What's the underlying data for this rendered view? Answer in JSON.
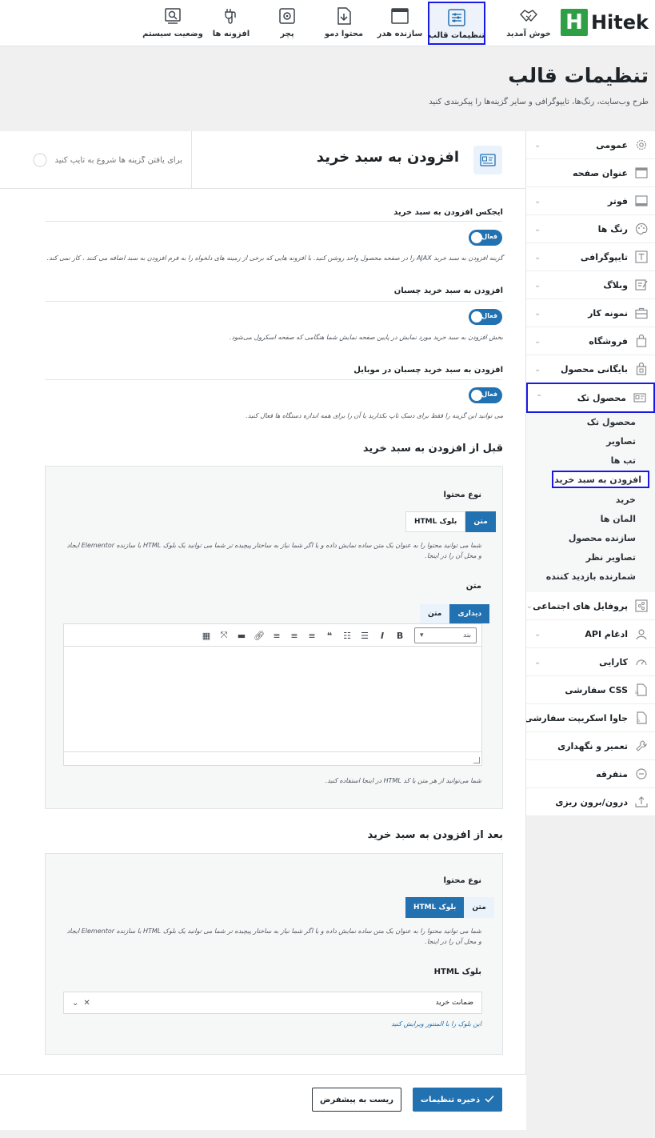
{
  "brand": {
    "logo_letter": "H",
    "logo_text": "Hitek",
    "logo_color": "#2f9f46"
  },
  "top_nav": {
    "items": [
      {
        "label": "خوش آمدید",
        "icon": "handshake-icon"
      },
      {
        "label": "تنظیمات قالب",
        "icon": "settings-panel-icon",
        "active": true
      },
      {
        "label": "سازنده هدر",
        "icon": "window-icon"
      },
      {
        "label": "محتوا دمو",
        "icon": "import-file-icon"
      },
      {
        "label": "پچر",
        "icon": "patch-gear-icon"
      },
      {
        "label": "افزونه ها",
        "icon": "plug-icon"
      },
      {
        "label": "وضعیت سیستم",
        "icon": "system-status-icon"
      }
    ]
  },
  "page": {
    "title": "تنظیمات قالب",
    "subtitle": "طرح وب‌سایت، رنگ‌ها، تایپوگرافی و سایر گزینه‌ها را پیکربندی کنید"
  },
  "sidebar": {
    "items": [
      {
        "label": "عمومی",
        "icon": "gear-icon",
        "chevron": true
      },
      {
        "label": "عنوان صفحه",
        "icon": "title-bar-icon",
        "chevron": false
      },
      {
        "label": "فوتر",
        "icon": "footer-icon",
        "chevron": true
      },
      {
        "label": "رنگ ها",
        "icon": "palette-icon",
        "chevron": true
      },
      {
        "label": "تایپوگرافی",
        "icon": "typography-icon",
        "chevron": true
      },
      {
        "label": "وبلاگ",
        "icon": "blog-icon",
        "chevron": true
      },
      {
        "label": "نمونه کار",
        "icon": "briefcase-icon",
        "chevron": true
      },
      {
        "label": "فروشگاه",
        "icon": "shopping-bag-icon",
        "chevron": true
      },
      {
        "label": "بایگانی محصول",
        "icon": "archive-bag-icon",
        "chevron": true
      },
      {
        "label": "محصول تک",
        "icon": "single-product-icon",
        "chevron": true,
        "active": true,
        "expanded": true
      }
    ],
    "sub_items": [
      {
        "label": "محصول تک"
      },
      {
        "label": "تصاویر"
      },
      {
        "label": "تب ها"
      },
      {
        "label": "افزودن به سبد خرید",
        "active": true
      },
      {
        "label": "خرید"
      },
      {
        "label": "المان ها"
      },
      {
        "label": "سازنده محصول"
      },
      {
        "label": "تصاویر نظر"
      },
      {
        "label": "شمارنده بازدید کننده"
      }
    ],
    "items_after": [
      {
        "label": "پروفایل های اجتماعی",
        "icon": "social-icon",
        "chevron": true
      },
      {
        "label": "ادغام API",
        "icon": "api-icon",
        "chevron": true
      },
      {
        "label": "کارایی",
        "icon": "speedometer-icon",
        "chevron": true
      },
      {
        "label": "CSS سفارشی",
        "icon": "css-file-icon",
        "chevron": false
      },
      {
        "label": "جاوا اسکریپت سفارشی",
        "icon": "js-file-icon",
        "chevron": false
      },
      {
        "label": "تعمیر و نگهداری",
        "icon": "wrench-icon",
        "chevron": false
      },
      {
        "label": "متفرقه",
        "icon": "more-circle-icon",
        "chevron": false
      },
      {
        "label": "درون/برون ریزی",
        "icon": "import-export-icon",
        "chevron": false
      }
    ]
  },
  "panel": {
    "title": "افزودن به سبد خرید",
    "search_placeholder": "برای یافتن گزینه ها شروع به تایپ کنید",
    "options": [
      {
        "label": "ایجکس افزودن به سبد خرید",
        "toggle": "فعال",
        "description": "گزینه افزودن به سبد خرید AJAX را در صفحه محصول واحد روشن کنید. با افزونه هایی که برخی از زمینه های دلخواه را به فرم افزودن به سبد اضافه می کنند ، کار نمی کند."
      },
      {
        "label": "افزودن به سبد خرید چسبان",
        "toggle": "فعال",
        "description": "بخش افزودن به سبد خرید مورد نمایش در پایین صفحه نمایش شما هنگامی که صفحه اسکرول می‌شود."
      },
      {
        "label": "افزودن به سبد خرید چسبان در موبایل",
        "toggle": "فعال",
        "description": "می توانید این گزینه را فقط برای دسک تاپ بکذارید یا آن را برای همه اندازه دستگاه ها فعال کنید."
      }
    ],
    "before": {
      "title": "قبل از افزودن به سبد خرید",
      "content_type_label": "نوع محتوا",
      "seg_text": "متن",
      "seg_html": "بلوک HTML",
      "content_type_desc": "شما می توانید محتوا را به عنوان یک متن ساده نمایش داده و یا اگر شما نیاز به ساختار پیچیده تر شما می توانید یک بلوک HTML با سازنده Elementor ایجاد و محل آن را در اینجا.",
      "text_label": "متن",
      "tab_visual": "دیداری",
      "tab_text": "متن",
      "paragraph_select": "بند",
      "text_hint": "شما می‌توانید از هر متن یا کد HTML در اینجا استفاده کنید."
    },
    "after": {
      "title": "بعد از افزودن به سبد خرید",
      "content_type_label": "نوع محتوا",
      "seg_text": "متن",
      "seg_html": "بلوک HTML",
      "content_type_desc": "شما می توانید محتوا را به عنوان یک متن ساده نمایش داده و یا اگر شما نیاز به ساختار پیچیده تر شما می توانید یک بلوک HTML با سازنده Elementor ایجاد و محل آن را در اینجا.",
      "html_block_label": "بلوک HTML",
      "html_block_value": "ضمانت خرید",
      "edit_link": "این بلوک را با المنتور ویرایش کنید"
    },
    "save_label": "ذخیره تنظیمات",
    "reset_label": "ریست به پیشفرض"
  },
  "colors": {
    "accent": "#2271b1",
    "highlight_border": "#1a1ae6"
  }
}
